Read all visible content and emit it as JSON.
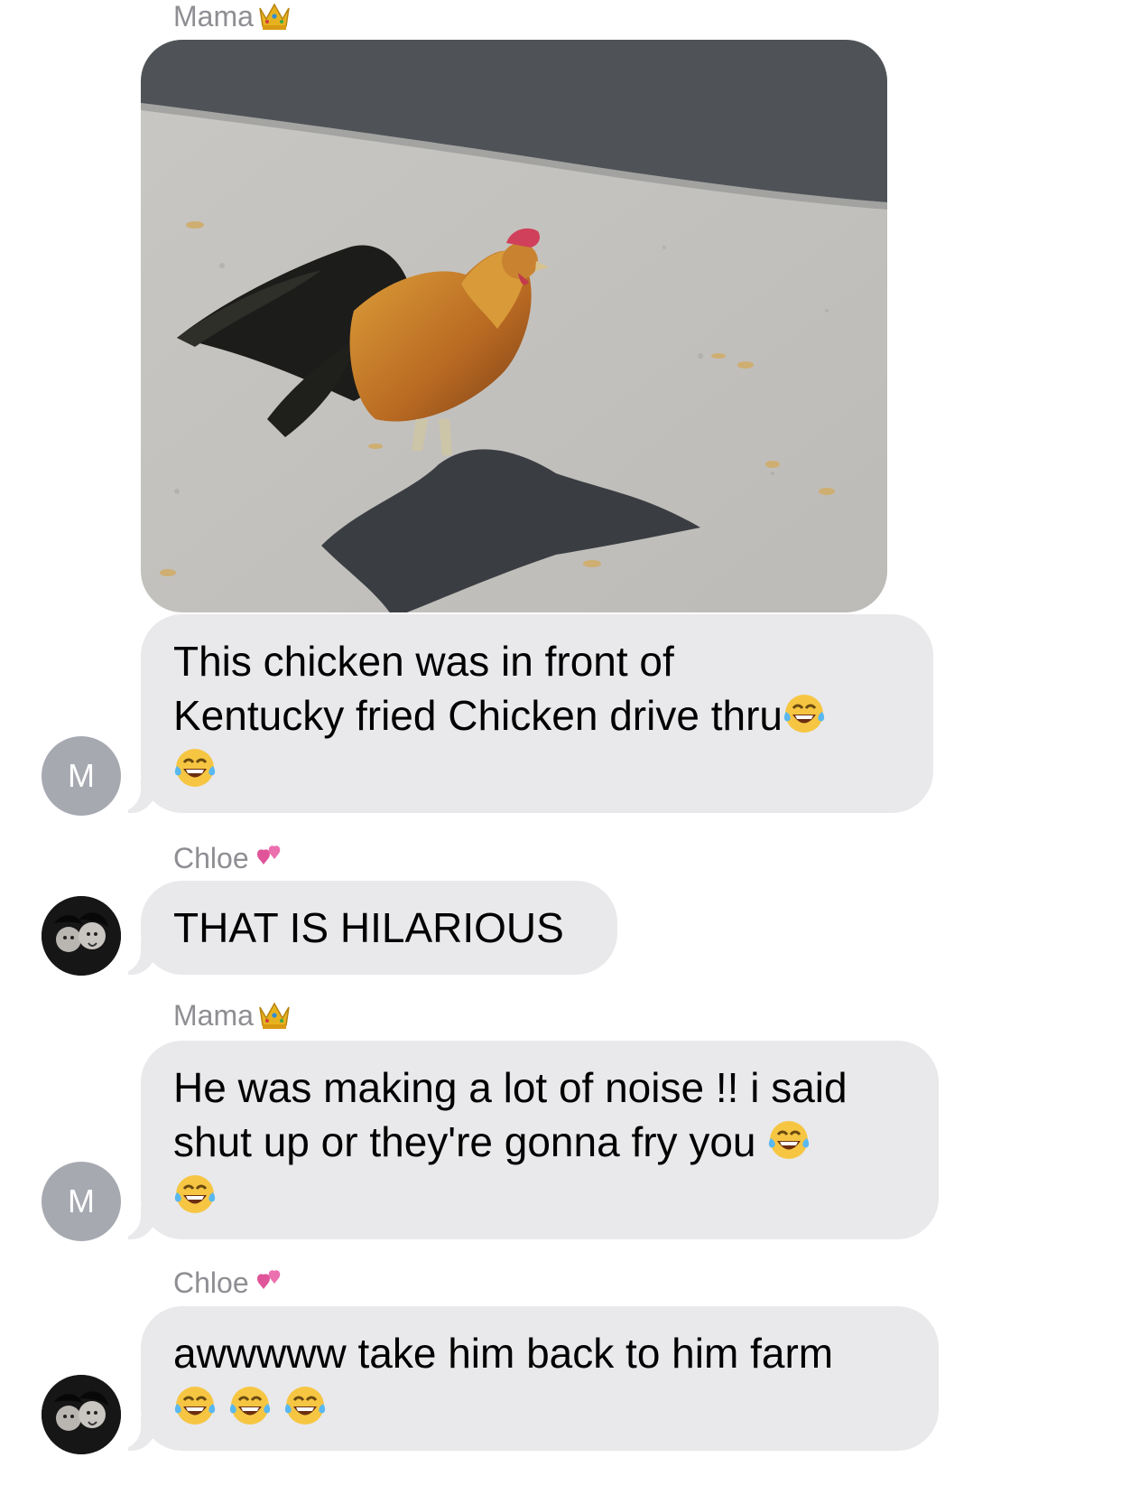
{
  "messages": [
    {
      "sender": "Mama",
      "sender_emoji": "crown-icon",
      "type": "photo",
      "photo_description_icon": "rooster-photo"
    },
    {
      "sender": "",
      "type": "text",
      "avatar_initial": "M",
      "lines": [
        "This chicken was in front of",
        "Kentucky fried Chicken drive thru"
      ],
      "emoji_count_line2": 1,
      "emoji_line3_count": 1
    },
    {
      "sender": "Chloe",
      "sender_emoji": "two-hearts-icon",
      "type": "text",
      "text": "THAT IS HILARIOUS"
    },
    {
      "sender": "Mama",
      "sender_emoji": "crown-icon",
      "type": "text",
      "avatar_initial": "M",
      "lines": [
        "He was making a lot of noise !! i said",
        "shut up or they're gonna fry you"
      ]
    },
    {
      "sender": "Chloe",
      "sender_emoji": "two-hearts-icon",
      "type": "text",
      "lines": [
        "awwwww take him back to him farm"
      ]
    }
  ],
  "labels": {
    "mama": "Mama",
    "chloe": "Chloe",
    "avatar_m": "M",
    "msg1_line1": "This chicken was in front of",
    "msg1_line2": "Kentucky fried Chicken drive thru",
    "msg2": "THAT IS HILARIOUS",
    "msg3_line1": "He was making a lot of noise !! i said",
    "msg3_line2": "shut up or they're gonna fry you",
    "msg4_line1": "awwwww take him back to him farm"
  },
  "colors": {
    "bubble_gray": "#e9e9eb",
    "sender_gray": "#8e8e93",
    "avatar_gray": "#a7a9b1"
  }
}
